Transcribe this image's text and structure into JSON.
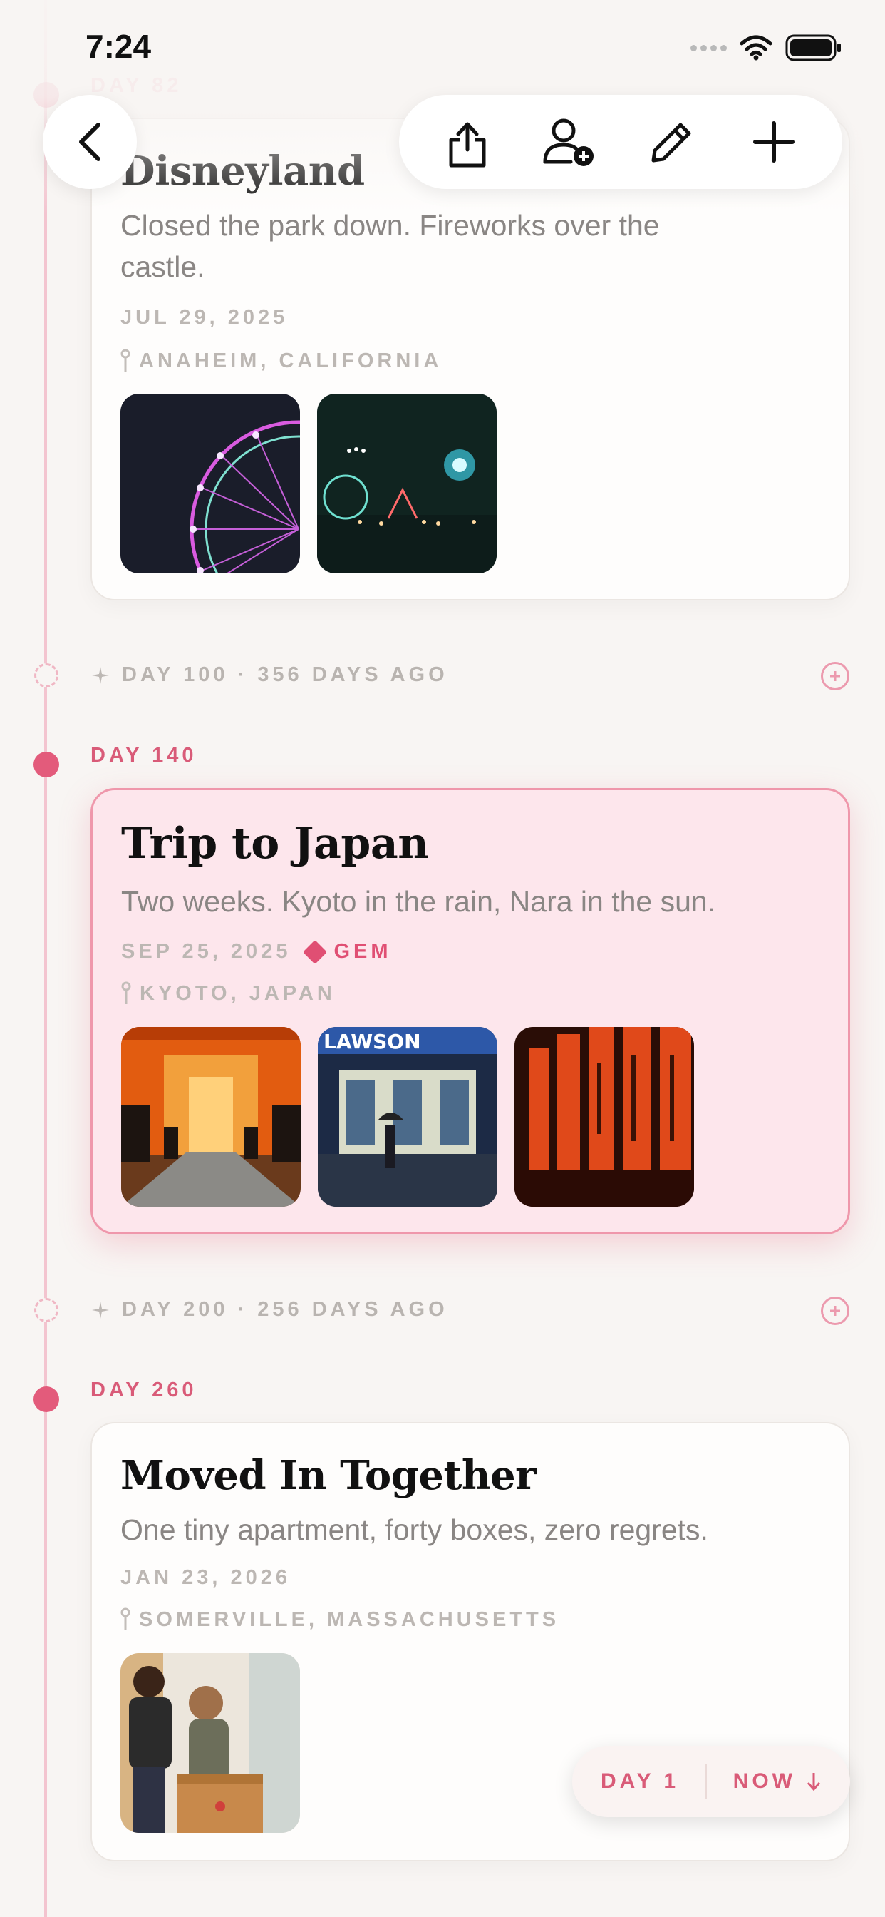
{
  "status": {
    "time": "7:24"
  },
  "nav": {
    "back": "back",
    "actions": [
      "share",
      "add-person",
      "edit",
      "add"
    ]
  },
  "entries": [
    {
      "day": "DAY 82",
      "title": "Disneyland",
      "desc": "Closed the park down. Fireworks over the castle.",
      "date": "JUL 29, 2025",
      "location": "ANAHEIM, CALIFORNIA",
      "photos": [
        "ferris-wheel-night",
        "carnival-lights"
      ]
    },
    {
      "day": "DAY 140",
      "title": "Trip to Japan",
      "desc": "Two weeks. Kyoto in the rain, Nara in the sun.",
      "date": "SEP 25, 2025",
      "badge": "GEM",
      "location": "KYOTO, JAPAN",
      "photos": [
        "torii-gates",
        "lawson-store",
        "torii-pillars"
      ],
      "lawson_sign": "LAWSON"
    },
    {
      "day": "DAY 260",
      "title": "Moved In Together",
      "desc": "One tiny apartment, forty boxes, zero regrets.",
      "date": "JAN 23, 2026",
      "location": "SOMERVILLE, MASSACHUSETTS",
      "photos": [
        "couple-boxes"
      ]
    }
  ],
  "milestones": [
    {
      "label": "DAY 100 · 356 DAYS AGO"
    },
    {
      "label": "DAY 200 · 256 DAYS AGO"
    }
  ],
  "jump": {
    "start": "DAY 1",
    "end": "NOW"
  },
  "colors": {
    "accent": "#e35b7b",
    "background": "#f8f5f3"
  }
}
